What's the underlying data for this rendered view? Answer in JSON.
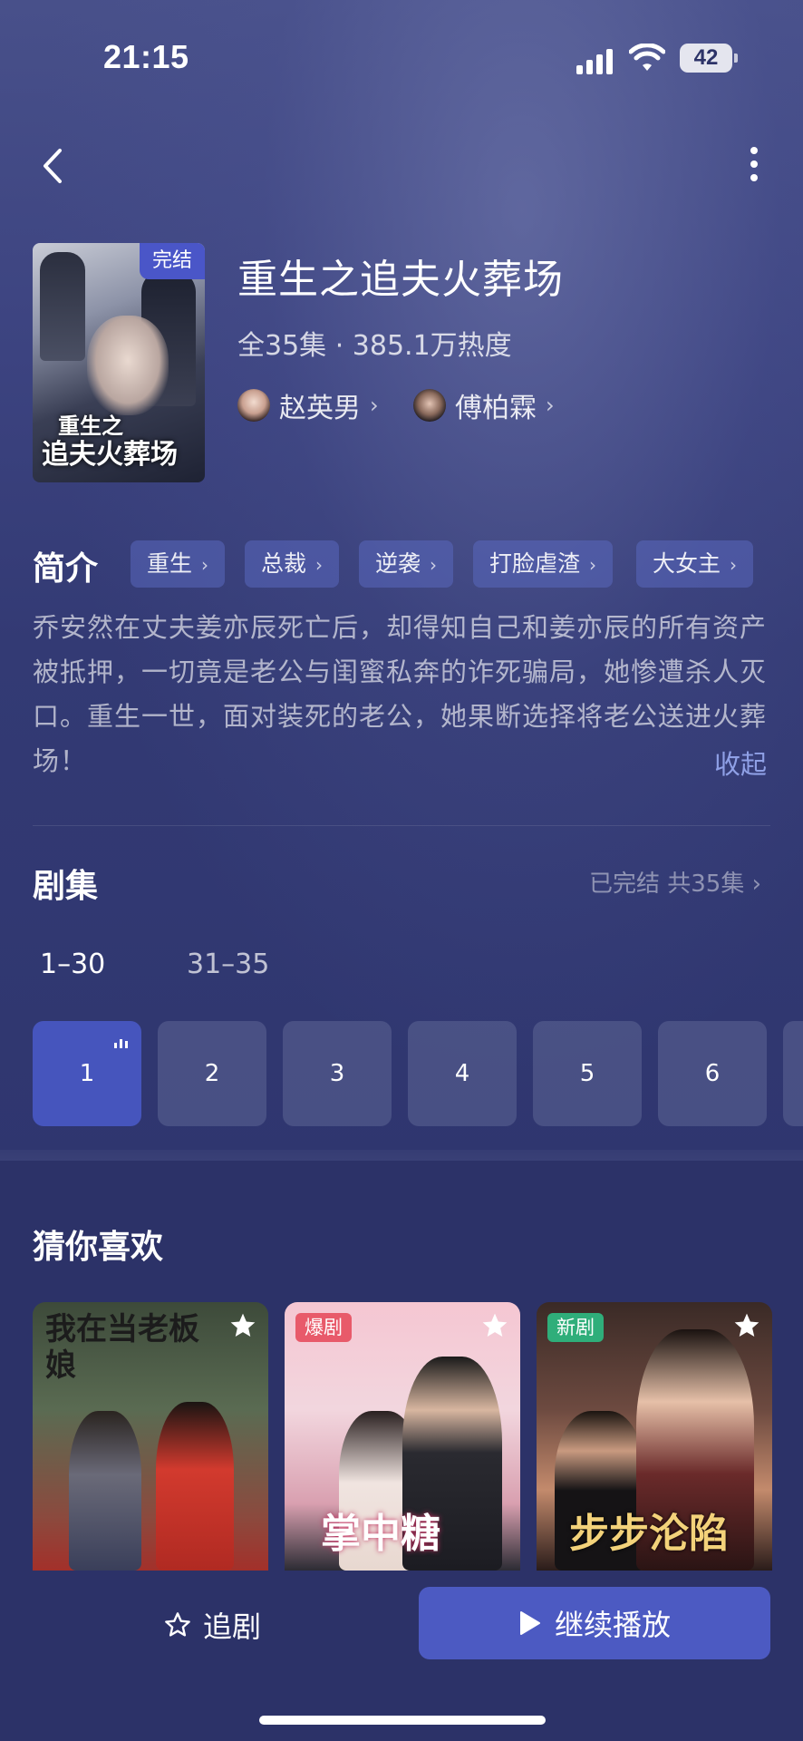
{
  "status": {
    "time": "21:15",
    "battery": "42"
  },
  "drama": {
    "title": "重生之追夫火葬场",
    "meta": "全35集 · 385.1万热度",
    "status_badge": "完结",
    "poster_title_1": "重生之",
    "poster_title_2": "追夫火葬场",
    "actors": [
      {
        "name": "赵英男"
      },
      {
        "name": "傅柏霖"
      }
    ]
  },
  "intro": {
    "label": "简介",
    "tags": [
      "重生",
      "总裁",
      "逆袭",
      "打脸虐渣",
      "大女主"
    ],
    "description": "乔安然在丈夫姜亦辰死亡后，却得知自己和姜亦辰的所有资产被抵押，一切竟是老公与闺蜜私奔的诈死骗局，她惨遭杀人灭口。重生一世，面对装死的老公，她果断选择将老公送进火葬场！",
    "collapse": "收起"
  },
  "episodes": {
    "label": "剧集",
    "status": "已完结 共35集",
    "ranges": [
      "1–30",
      "31–35"
    ],
    "items": [
      "1",
      "2",
      "3",
      "4",
      "5",
      "6"
    ],
    "active": "1"
  },
  "recommend": {
    "label": "猜你喜欢",
    "cards": [
      {
        "title": "我在当老板娘",
        "badge": ""
      },
      {
        "title": "掌中糖",
        "badge": "爆剧"
      },
      {
        "title": "步步沦陷",
        "badge": "新剧"
      }
    ]
  },
  "bottom": {
    "follow": "追剧",
    "play": "继续播放"
  },
  "colors": {
    "accent": "#4c5ac2",
    "background": "#2c3368",
    "link": "#8fa0e6"
  }
}
